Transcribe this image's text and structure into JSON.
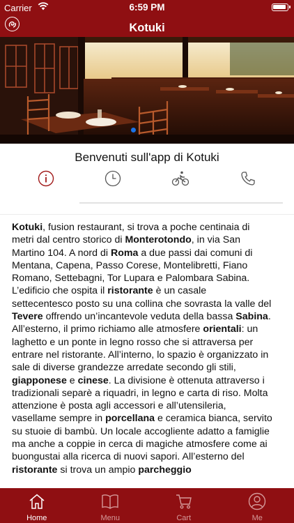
{
  "status_bar": {
    "carrier": "Carrier",
    "time": "6:59 PM"
  },
  "nav": {
    "title": "Kotuki"
  },
  "welcome": "Benvenuti sull'app di Kotuki",
  "info_icons": [
    "info-icon",
    "clock-icon",
    "bike-icon",
    "phone-icon"
  ],
  "description": [
    [
      {
        "b": "Kotuki"
      },
      {
        "t": ", fusion restaurant, si trova a poche centinaia di"
      }
    ],
    [
      {
        "t": "metri dal centro storico di "
      },
      {
        "b": "Monterotondo"
      },
      {
        "t": ", in via San"
      }
    ],
    [
      {
        "t": "Martino 104. A nord di "
      },
      {
        "b": "Roma"
      },
      {
        "t": " a due passi dai comuni di"
      }
    ],
    [
      {
        "t": "Mentana, Capena, Passo Corese, Montelibretti, Fiano"
      }
    ],
    [
      {
        "t": "Romano, Settebagni, Tor Lupara e Palombara Sabina."
      }
    ],
    [
      {
        "t": "L’edificio che ospita il "
      },
      {
        "b": "ristorante"
      },
      {
        "t": " è un casale"
      }
    ],
    [
      {
        "t": "settecentesco posto su una collina che sovrasta la valle del"
      }
    ],
    [
      {
        "b": "Tevere"
      },
      {
        "t": " offrendo un’incantevole veduta della bassa "
      },
      {
        "b": "Sabina"
      },
      {
        "t": "."
      }
    ],
    [
      {
        "t": "All’esterno, il primo richiamo alle atmosfere "
      },
      {
        "b": "orientali"
      },
      {
        "t": ": un"
      }
    ],
    [
      {
        "t": "laghetto e un ponte in legno rosso che si attraversa per"
      }
    ],
    [
      {
        "t": "entrare nel ristorante. All’interno, lo spazio è organizzato in"
      }
    ],
    [
      {
        "t": "sale di diverse grandezze arredate secondo gli stili,"
      }
    ],
    [
      {
        "b": "giapponese"
      },
      {
        "t": " e "
      },
      {
        "b": "cinese"
      },
      {
        "t": ". La divisione è ottenuta attraverso i"
      }
    ],
    [
      {
        "t": "tradizionali separè a riquadri, in legno e carta di riso. Molta"
      }
    ],
    [
      {
        "t": "attenzione è posta agli accessori e all’utensileria,"
      }
    ],
    [
      {
        "t": "vasellame sempre in "
      },
      {
        "b": "porcellana"
      },
      {
        "t": " e ceramica bianca, servito"
      }
    ],
    [
      {
        "t": "su stuoie di bambù. Un locale accogliente adatto a famiglie"
      }
    ],
    [
      {
        "t": "ma anche a coppie in cerca di magiche atmosfere come ai"
      }
    ],
    [
      {
        "t": "buongustai alla ricerca di nuovi sapori. All’esterno del"
      }
    ],
    [
      {
        "b": "ristorante"
      },
      {
        "t": " si trova un ampio "
      },
      {
        "b": "parcheggio"
      }
    ]
  ],
  "tabs": [
    {
      "label": "Home",
      "icon": "home-icon",
      "active": true
    },
    {
      "label": "Menu",
      "icon": "book-icon",
      "active": false
    },
    {
      "label": "Cart",
      "icon": "cart-icon",
      "active": false
    },
    {
      "label": "Me",
      "icon": "user-icon",
      "active": false
    }
  ],
  "colors": {
    "brand": "#8f0f12",
    "icon_accent": "#a01818",
    "inactive_tab": "#d59a9a"
  }
}
